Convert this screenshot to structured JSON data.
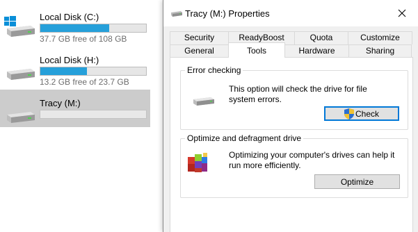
{
  "explorer": {
    "drives": [
      {
        "name": "Local Disk (C:)",
        "free_text": "37.7 GB free of 108 GB",
        "used_fraction": 0.651,
        "icon": "windows-drive-icon"
      },
      {
        "name": "Local Disk (H:)",
        "free_text": "13.2 GB free of 23.7 GB",
        "used_fraction": 0.443,
        "icon": "hard-drive-icon"
      },
      {
        "name": "Tracy (M:)",
        "free_text": "",
        "used_fraction": 0.0,
        "icon": "hard-drive-icon",
        "selected": true
      }
    ]
  },
  "dialog": {
    "title": "Tracy (M:) Properties",
    "close_icon": "close-icon",
    "tabs_row1": [
      "Security",
      "ReadyBoost",
      "Quota",
      "Customize"
    ],
    "tabs_row2": [
      "General",
      "Tools",
      "Hardware",
      "Sharing"
    ],
    "active_tab": "Tools",
    "error_checking": {
      "title": "Error checking",
      "description": "This option will check the drive for file system errors.",
      "button_label": "Check",
      "icon": "drive-icon",
      "button_icon": "uac-shield-icon"
    },
    "optimize": {
      "title": "Optimize and defragment drive",
      "description": "Optimizing your computer's drives can help it run more efficiently.",
      "button_label": "Optimize",
      "icon": "defrag-icon"
    }
  },
  "colors": {
    "progress_fill": "#26a0da",
    "selection_bg": "#cccccc",
    "dialog_bg": "#f0f0f0",
    "default_button_border": "#0078d7"
  }
}
